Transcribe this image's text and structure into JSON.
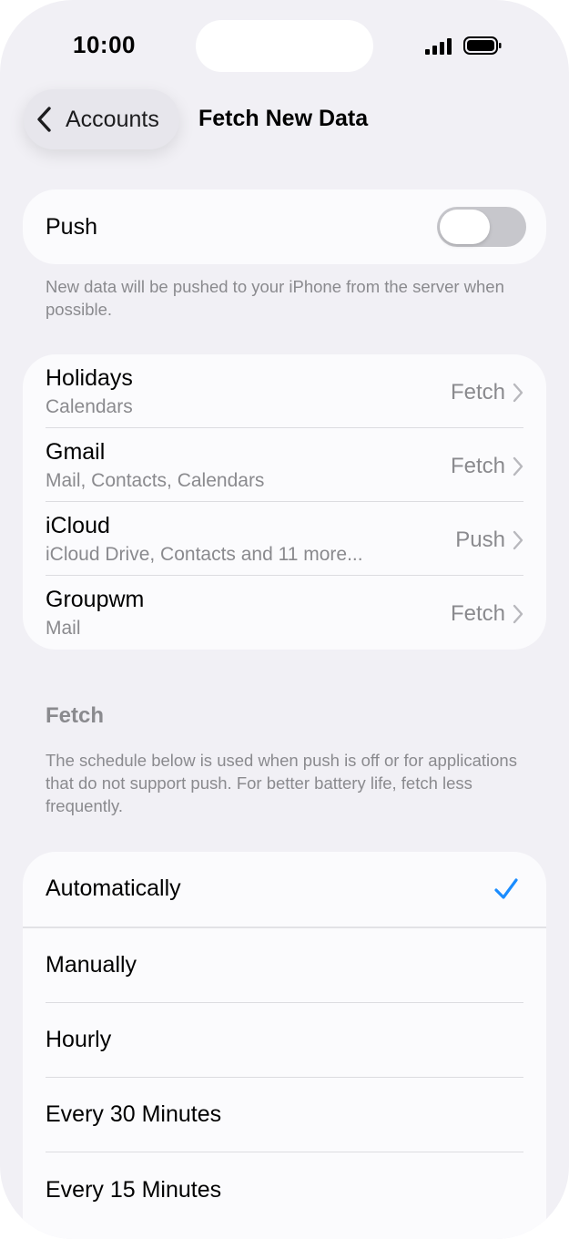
{
  "status_bar": {
    "time": "10:00"
  },
  "nav": {
    "back_label": "Accounts",
    "title": "Fetch New Data"
  },
  "push": {
    "label": "Push",
    "enabled": false,
    "footnote": "New data will be pushed to your iPhone from the server when possible."
  },
  "accounts": [
    {
      "name": "Holidays",
      "services": "Calendars",
      "value": "Fetch"
    },
    {
      "name": "Gmail",
      "services": "Mail, Contacts, Calendars",
      "value": "Fetch"
    },
    {
      "name": "iCloud",
      "services": "iCloud Drive, Contacts and 11 more...",
      "value": "Push"
    },
    {
      "name": "Groupwm",
      "services": "Mail",
      "value": "Fetch"
    }
  ],
  "fetch": {
    "header": "Fetch",
    "footnote": "The schedule below is used when push is off or for applications that do not support push. For better battery life, fetch less frequently.",
    "options": [
      {
        "label": "Automatically",
        "selected": true
      },
      {
        "label": "Manually",
        "selected": false
      },
      {
        "label": "Hourly",
        "selected": false
      },
      {
        "label": "Every 30 Minutes",
        "selected": false
      },
      {
        "label": "Every 15 Minutes",
        "selected": false
      }
    ]
  },
  "colors": {
    "accent": "#1a8cff",
    "background": "#f1f0f5",
    "secondary_text": "#8a8a8e"
  },
  "icons": {
    "back": "chevron-left-icon",
    "disclosure": "chevron-right-icon",
    "check": "checkmark-icon",
    "signal": "cellular-signal-icon",
    "battery": "battery-icon"
  }
}
